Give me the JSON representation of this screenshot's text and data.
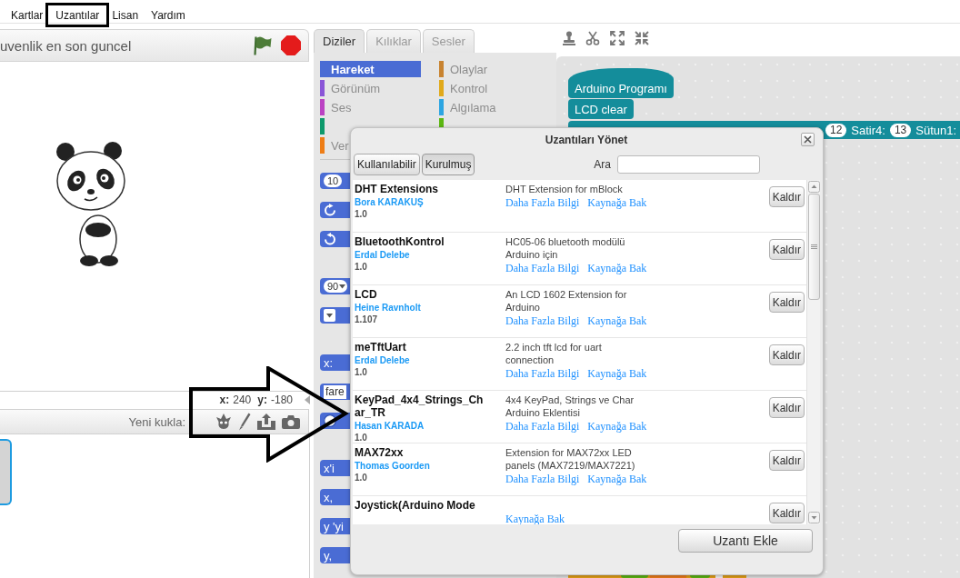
{
  "menu_bar": {
    "items": [
      {
        "label": "Kartlar",
        "highlighted": false
      },
      {
        "label": "Uzantılar",
        "highlighted": true
      },
      {
        "label": "Lisan",
        "highlighted": false
      },
      {
        "label": "Yardım",
        "highlighted": false
      }
    ]
  },
  "stage": {
    "title": "uvenlik en son guncel",
    "coords": {
      "x_label": "x:",
      "x_value": "240",
      "y_label": "y:",
      "y_value": "-180"
    }
  },
  "sprites": {
    "new_sprite_label": "Yeni kukla:",
    "items": [
      {
        "selected": true
      }
    ]
  },
  "tabs": [
    {
      "label": "Diziler",
      "selected": true
    },
    {
      "label": "Kılıklar",
      "selected": false
    },
    {
      "label": "Sesler",
      "selected": false
    }
  ],
  "categories": [
    {
      "label": "Hareket",
      "color": "#4a6cd4",
      "selected": true
    },
    {
      "label": "Olaylar",
      "color": "#c88330",
      "selected": false
    },
    {
      "label": "Görünüm",
      "color": "#8a55d7",
      "selected": false
    },
    {
      "label": "Kontrol",
      "color": "#e1a91a",
      "selected": false
    },
    {
      "label": "Ses",
      "color": "#bb42c3",
      "selected": false
    },
    {
      "label": "Algılama",
      "color": "#2ca5e2",
      "selected": false
    },
    {
      "color": "#0e9a6c",
      "selected": false
    },
    {
      "color": "#5cb712",
      "selected": false
    },
    {
      "label": "Ver",
      "color": "#ee7d16",
      "selected": false
    }
  ],
  "palette_block_groups": [
    [
      {
        "kind": "number",
        "text": "10"
      },
      {
        "kind": "turn_right"
      },
      {
        "kind": "turn_left"
      }
    ],
    [
      {
        "kind": "dropdown",
        "text": "90"
      },
      {
        "kind": "dropdown"
      }
    ],
    [
      {
        "kind": "label",
        "text": "x:"
      },
      {
        "kind": "input",
        "text": "fare"
      },
      {
        "kind": "circle"
      }
    ],
    [
      {
        "kind": "label",
        "text": "x'i"
      },
      {
        "kind": "label",
        "text": "x,"
      },
      {
        "kind": "label",
        "text": "y 'yi"
      },
      {
        "kind": "label",
        "text": "y,"
      }
    ]
  ],
  "script": {
    "blocks": [
      {
        "kind": "hat",
        "text": "Arduino Programı"
      },
      {
        "kind": "command",
        "text": "LCD clear"
      },
      {
        "kind": "command_args",
        "parts": [
          {
            "kind": "number",
            "text": "12"
          },
          {
            "kind": "label",
            "text": "Satir4:"
          },
          {
            "kind": "number",
            "text": "13"
          },
          {
            "kind": "label",
            "text": "Sütun1:"
          }
        ]
      },
      {
        "kind": "cut_off"
      }
    ]
  },
  "dialog": {
    "title": "Uzantıları Yönet",
    "filters": [
      {
        "label": "Kullanılabilir",
        "selected": false
      },
      {
        "label": "Kurulmuş",
        "selected": true
      }
    ],
    "search": {
      "label": "Ara"
    },
    "extensions": [
      {
        "name": "DHT Extensions",
        "author": "Bora KARAKUŞ",
        "version": "1.0",
        "description": "DHT Extension for mBlock",
        "links": [
          "Daha Fazla Bilgi",
          "Kaynağa Bak"
        ],
        "remove_button": "Kaldır"
      },
      {
        "name": "BluetoothKontrol",
        "author": "Erdal Delebe",
        "version": "1.0",
        "description": "HC05-06 bluetooth modülü Arduino için",
        "links": [
          "Daha Fazla Bilgi",
          "Kaynağa Bak"
        ],
        "remove_button": "Kaldır"
      },
      {
        "name": "LCD",
        "author": "Heine Ravnholt",
        "version": "1.107",
        "description": "An LCD 1602 Extension for Arduino",
        "links": [
          "Daha Fazla Bilgi",
          "Kaynağa Bak"
        ],
        "remove_button": "Kaldır"
      },
      {
        "name": "meTftUart",
        "author": "Erdal Delebe",
        "version": "1.0",
        "description": "2.2 inch tft lcd for uart connection",
        "links": [
          "Daha Fazla Bilgi",
          "Kaynağa Bak"
        ],
        "remove_button": "Kaldır"
      },
      {
        "name": "KeyPad_4x4_Strings_Char_TR",
        "author": "Hasan KARADA",
        "version": "1.0",
        "description": "4x4 KeyPad, Strings ve Char Arduino Eklentisi",
        "links": [
          "Daha Fazla Bilgi",
          "Kaynağa Bak"
        ],
        "remove_button": "Kaldır"
      },
      {
        "name": "MAX72xx",
        "author": "Thomas Goorden",
        "version": "1.0",
        "description": "Extension for MAX72xx LED panels (MAX7219/MAX7221)",
        "links": [
          "Daha Fazla Bilgi",
          "Kaynağa Bak"
        ],
        "remove_button": "Kaldır"
      },
      {
        "name": "Joystick(Arduino Mode",
        "links": [
          "Kaynağa Bak"
        ],
        "remove_button": "Kaldır"
      }
    ],
    "add_button": "Uzantı Ekle"
  },
  "annotations": [
    {
      "kind": "arrow"
    }
  ]
}
